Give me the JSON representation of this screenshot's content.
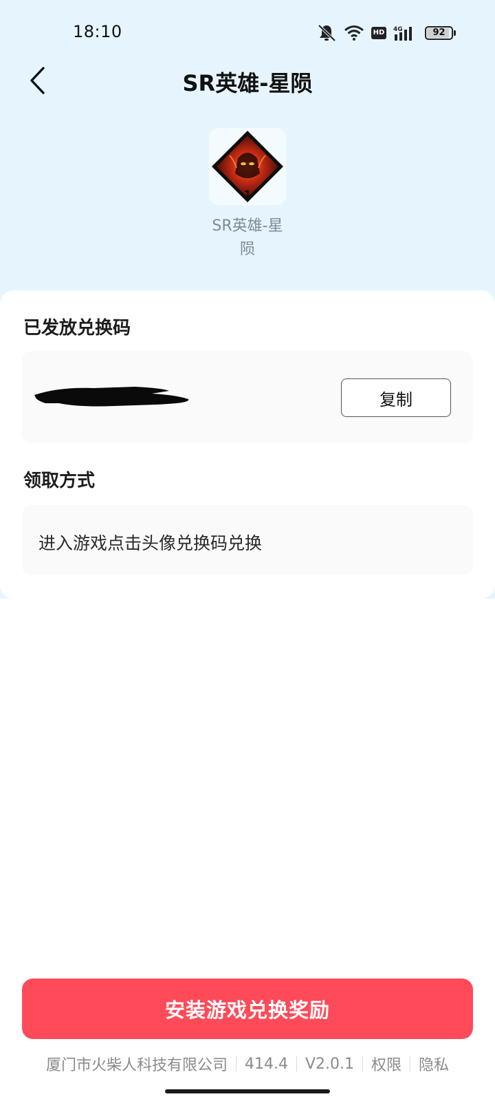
{
  "status_bar": {
    "time": "18:10",
    "network": "4G",
    "hd": "HD",
    "battery_level": "92",
    "battery_fraction": 0.92,
    "icons": [
      "bell-muted-icon",
      "wifi-icon",
      "hd-icon",
      "signal-4g-icon",
      "battery-icon"
    ]
  },
  "header": {
    "title": "SR英雄-星陨",
    "back_icon": "chevron-left-icon"
  },
  "reward": {
    "count": "1",
    "name": "SR英雄-星陨"
  },
  "code_section": {
    "title": "已发放兑换码",
    "copy_label": "复制"
  },
  "method_section": {
    "title": "领取方式",
    "text": "进入游戏点击头像兑换码兑换"
  },
  "install_button": {
    "label": "安装游戏兑换奖励"
  },
  "footer": {
    "company": "厦门市火柴人科技有限公司",
    "size": "414.4",
    "version": "V2.0.1",
    "permissions": "权限",
    "privacy": "隐私"
  },
  "colors": {
    "hero_background": "#e6f5fd",
    "accent": "#ff4a59",
    "footer_text": "#8a8a8a"
  }
}
